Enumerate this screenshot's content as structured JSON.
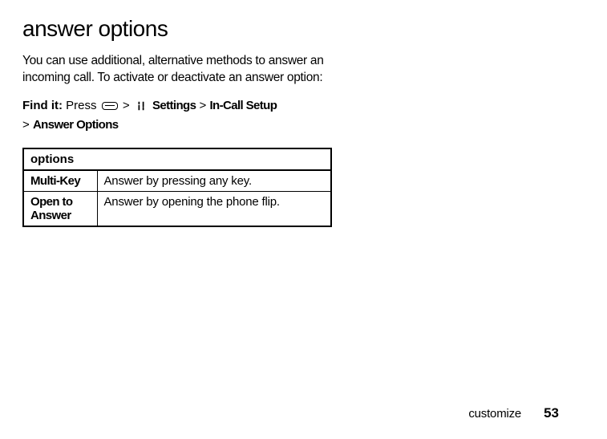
{
  "heading": "answer options",
  "intro": "You can use additional, alternative methods to answer an incoming call. To activate or deactivate an answer option:",
  "find_it": {
    "label": "Find it:",
    "press": "Press",
    "sep": ">",
    "settings": "Settings",
    "in_call_setup": "In-Call Setup",
    "answer_options": "Answer Options"
  },
  "table": {
    "header": "options",
    "rows": [
      {
        "name": "Multi-Key",
        "desc": "Answer by pressing any key."
      },
      {
        "name": "Open to Answer",
        "desc": "Answer by opening the phone flip."
      }
    ]
  },
  "footer": {
    "section": "customize",
    "page": "53"
  }
}
